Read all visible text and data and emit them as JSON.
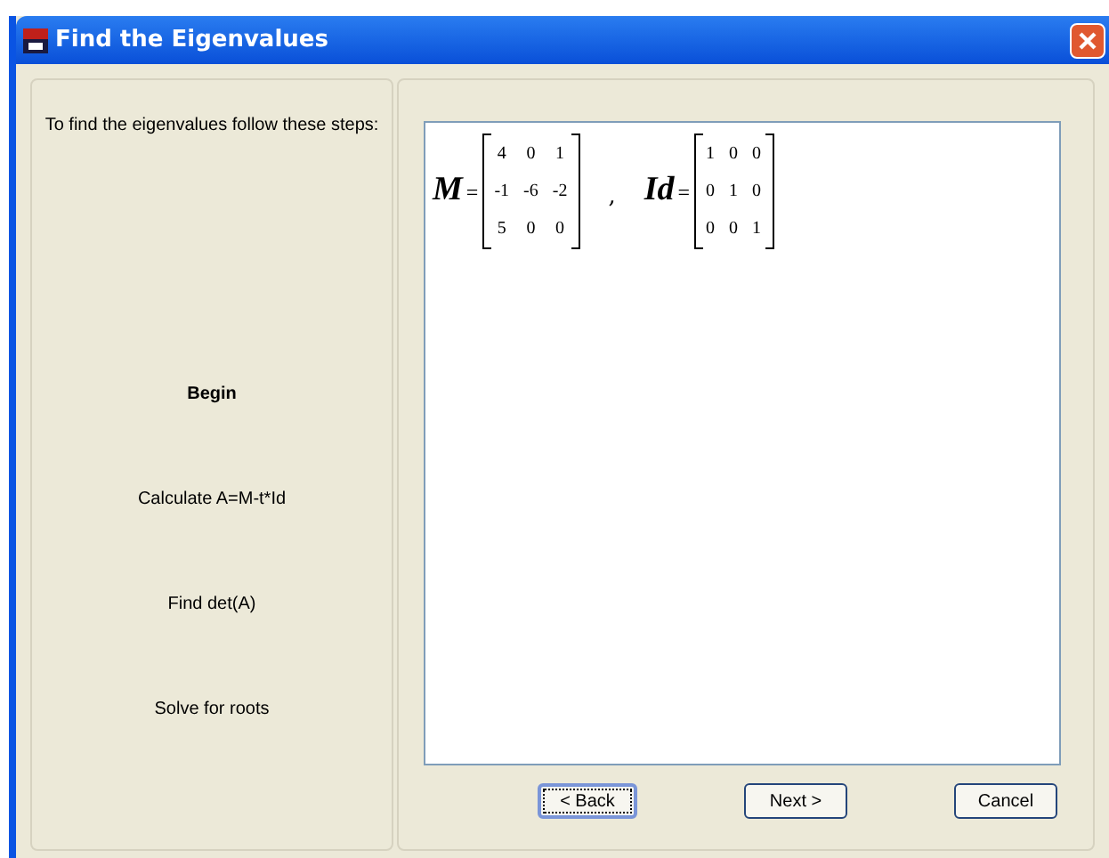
{
  "window": {
    "title": "Find the Eigenvalues"
  },
  "steps_panel": {
    "intro": "To find the eigenvalues follow these steps:",
    "steps": [
      {
        "label": "Begin",
        "selected": true
      },
      {
        "label": "Calculate A=M-t*Id",
        "selected": false
      },
      {
        "label": "Find det(A)",
        "selected": false
      },
      {
        "label": "Solve for roots",
        "selected": false
      }
    ]
  },
  "matrices": [
    {
      "name": "M",
      "equals": "=",
      "rows": [
        [
          "4",
          "0",
          "1"
        ],
        [
          "-1",
          "-6",
          "-2"
        ],
        [
          "5",
          "0",
          "0"
        ]
      ]
    },
    {
      "name": "Id",
      "equals": "=",
      "rows": [
        [
          "1",
          "0",
          "0"
        ],
        [
          "0",
          "1",
          "0"
        ],
        [
          "0",
          "0",
          "1"
        ]
      ]
    }
  ],
  "separator": ",",
  "buttons": [
    {
      "label": "< Back",
      "focused": true
    },
    {
      "label": "Next >",
      "focused": false
    },
    {
      "label": "Cancel",
      "focused": false
    }
  ]
}
